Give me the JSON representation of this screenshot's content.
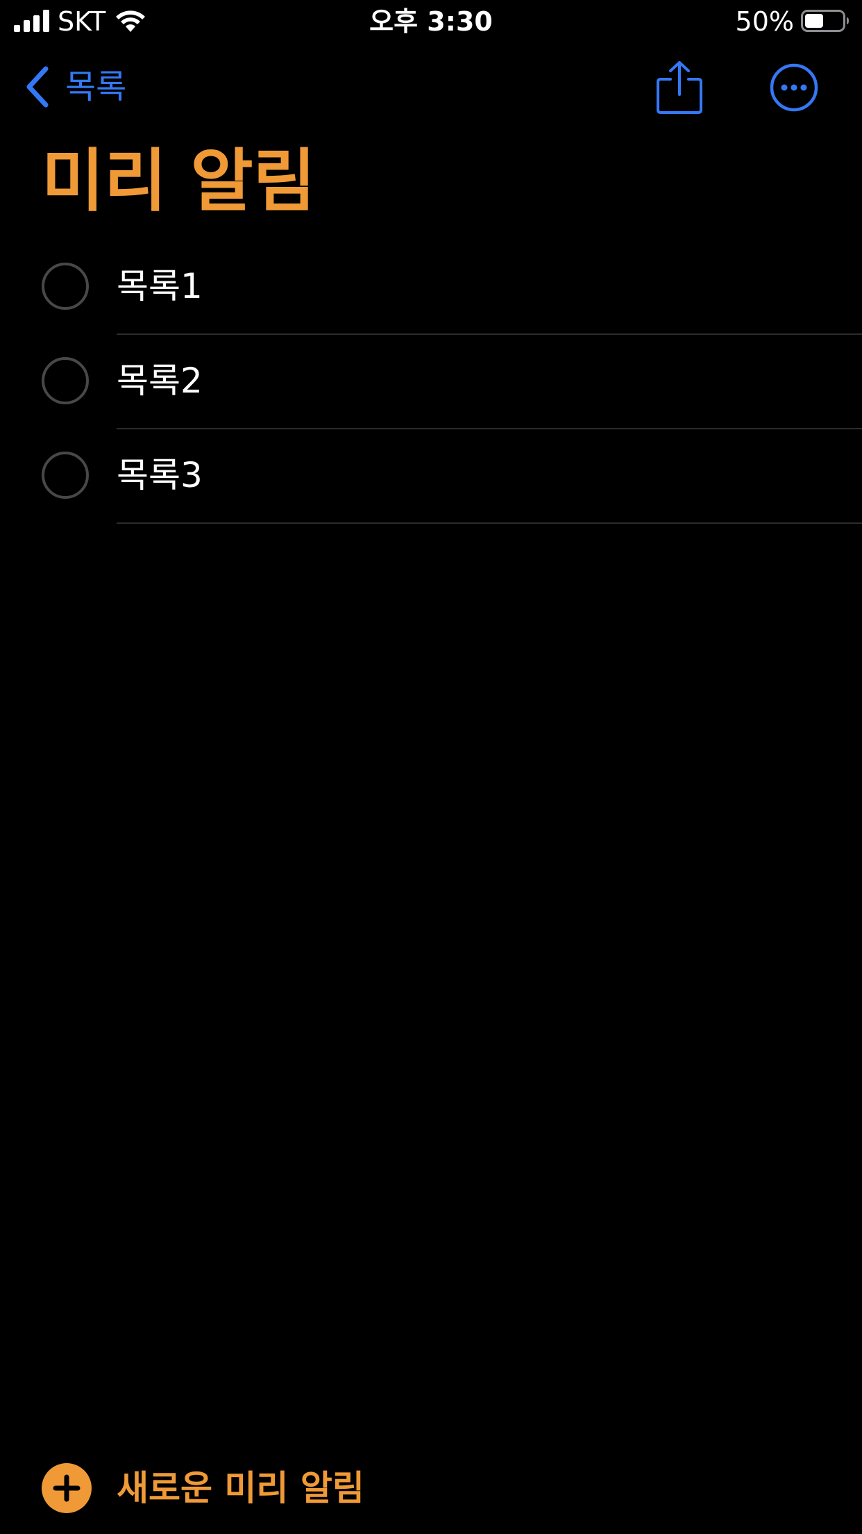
{
  "status_bar": {
    "carrier": "SKT",
    "time": "오후 3:30",
    "battery_percent": "50%",
    "battery_level": 0.5,
    "icons": [
      "signal-icon",
      "wifi-icon",
      "battery-icon"
    ]
  },
  "nav": {
    "back_label": "목록",
    "icons": [
      "chevron-left-icon",
      "share-icon",
      "more-icon"
    ]
  },
  "title": "미리 알림",
  "reminders": [
    {
      "text": "목록1"
    },
    {
      "text": "목록2"
    },
    {
      "text": "목록3"
    }
  ],
  "footer": {
    "new_reminder_label": "새로운 미리 알림",
    "icon": "plus-circle-icon"
  },
  "colors": {
    "accent_orange": "#f09a37",
    "link_blue": "#3478f6",
    "background": "#000000",
    "circle_border": "#48484a",
    "divider": "#2c2c2e"
  }
}
